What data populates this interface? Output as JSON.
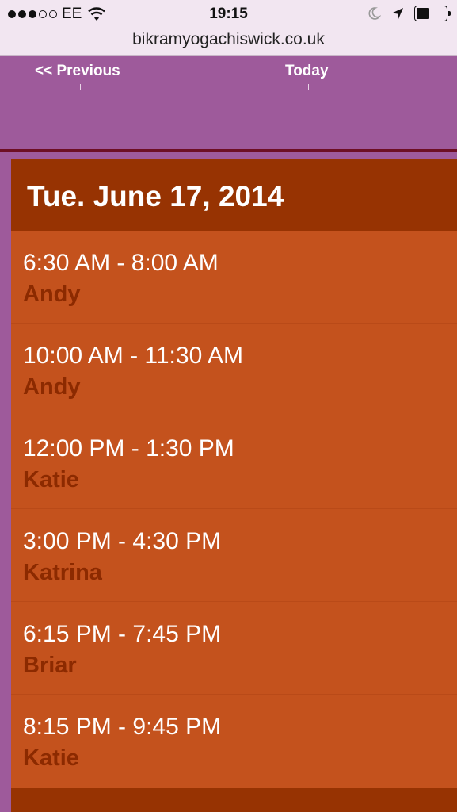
{
  "status_bar": {
    "carrier": "EE",
    "signal_bars": 3,
    "time": "19:15",
    "battery_level": 0.45
  },
  "browser": {
    "url": "bikramyogachiswick.co.uk"
  },
  "nav": {
    "previous_label": "<< Previous",
    "today_label": "Today"
  },
  "day": {
    "title": "Tue. June 17, 2014",
    "events": [
      {
        "time": "6:30 AM - 8:00 AM",
        "teacher": "Andy"
      },
      {
        "time": "10:00 AM - 11:30 AM",
        "teacher": "Andy"
      },
      {
        "time": "12:00 PM - 1:30 PM",
        "teacher": "Katie"
      },
      {
        "time": "3:00 PM - 4:30 PM",
        "teacher": "Katrina"
      },
      {
        "time": "6:15 PM - 7:45 PM",
        "teacher": "Briar"
      },
      {
        "time": "8:15 PM - 9:45 PM",
        "teacher": "Katie"
      }
    ]
  },
  "colors": {
    "page_background": "#9e5a9b",
    "panel": "#c4521d",
    "header": "#973302",
    "teacher_text": "#8c2a00"
  }
}
